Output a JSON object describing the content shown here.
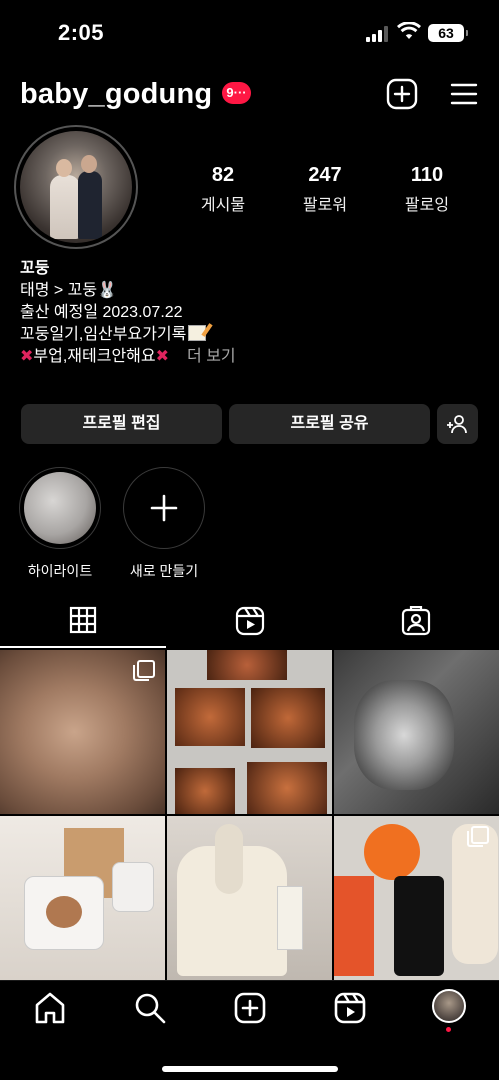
{
  "status_bar": {
    "time": "2:05",
    "battery": "63"
  },
  "header": {
    "username": "baby_godung",
    "notification_badge": "9···",
    "add_icon": "plus-square-icon",
    "menu_icon": "hamburger-menu-icon"
  },
  "profile": {
    "stats": [
      {
        "count": "82",
        "label": "게시물"
      },
      {
        "count": "247",
        "label": "팔로워"
      },
      {
        "count": "110",
        "label": "팔로잉"
      }
    ],
    "bio": {
      "name": "꼬둥",
      "line1": "태명 > 꼬둥🐰",
      "line2": "출산 예정일 2023.07.22",
      "line3": "꼬둥일기,임산부요가기록",
      "line4": "부업,재테크안해요",
      "more": "더 보기"
    }
  },
  "buttons": {
    "edit_profile": "프로필 편집",
    "share_profile": "프로필 공유",
    "add_person_icon": "add-person-icon"
  },
  "highlights": [
    {
      "label": "하이라이트"
    },
    {
      "label": "새로 만들기"
    }
  ],
  "tabs": [
    "grid-icon",
    "reels-icon",
    "tagged-icon"
  ],
  "colors": {
    "background": "#000000",
    "button": "#262626",
    "badge": "#ff1744",
    "muted": "#a8a8a8"
  },
  "nav": [
    "home-icon",
    "search-icon",
    "create-icon",
    "reels-icon",
    "profile-avatar"
  ]
}
